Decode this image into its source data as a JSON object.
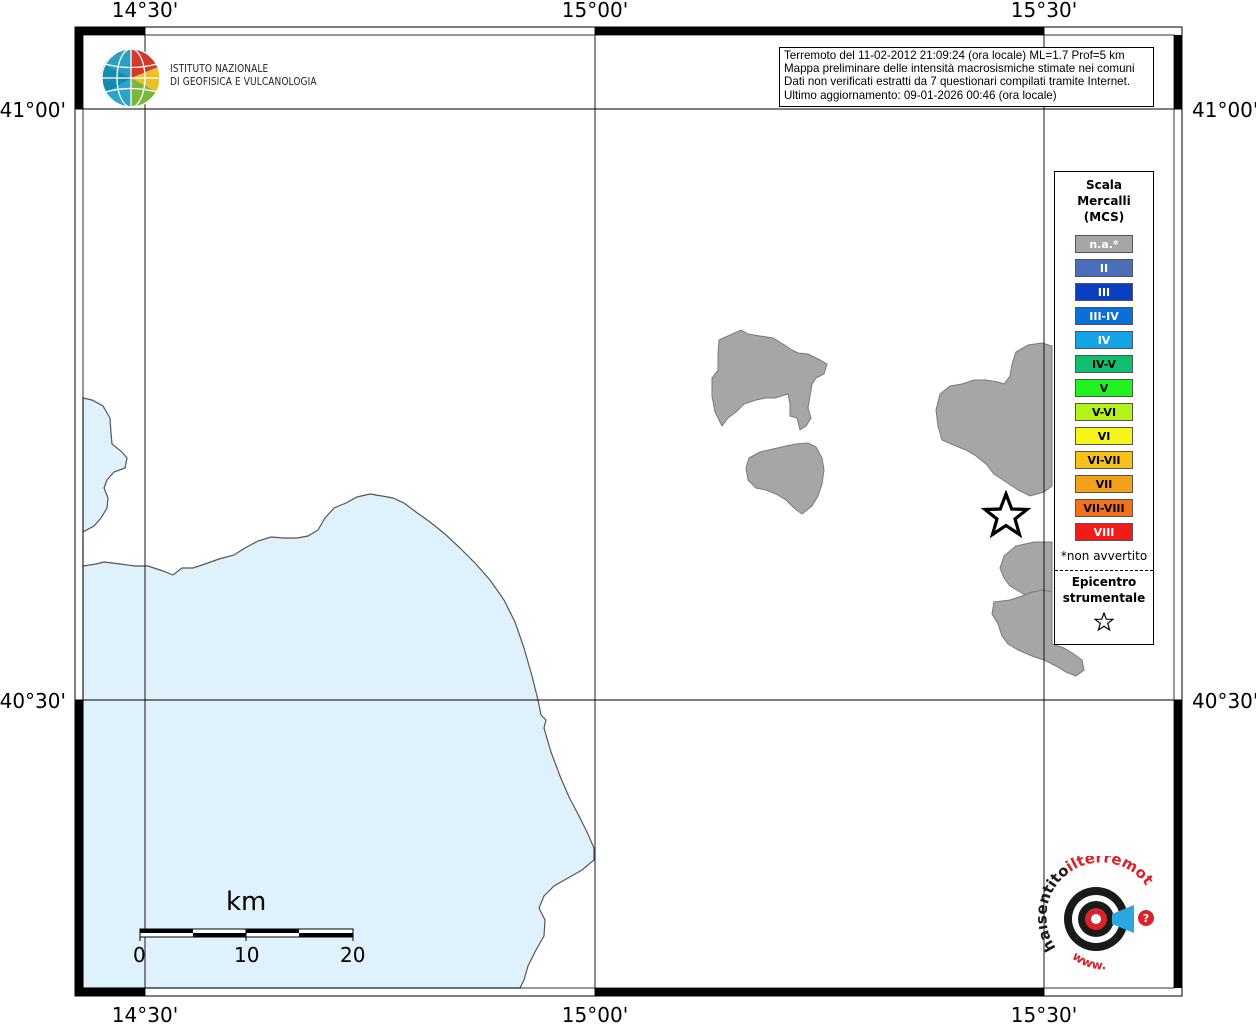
{
  "map": {
    "graticule": {
      "top_labels": [
        "14°30'",
        "15°00'",
        "15°30'"
      ],
      "bottom_labels": [
        "14°30'",
        "15°00'",
        "15°30'"
      ],
      "left_labels": [
        "41°00'",
        "40°30'"
      ],
      "right_labels": [
        "41°00'",
        "40°30'"
      ]
    },
    "colors": {
      "sea": "#dff1fb",
      "coastline": "#555555",
      "municipality_fill": "#a6a6a6",
      "municipality_stroke": "#7a7a7a"
    }
  },
  "header": {
    "logo_line1": "ISTITUTO NAZIONALE",
    "logo_line2": "DI GEOFISICA E VULCANOLOGIA"
  },
  "info_box": {
    "line1": "Terremoto del 11-02-2012 21:09:24 (ora locale) ML=1.7 Prof=5 km",
    "line2": "Mappa preliminare delle intensità macrosismiche stimate nei comuni",
    "line3": "Dati non verificati estratti da 7 questionari compilati tramite Internet.",
    "line4": "Ultimo aggiornamento: 09-01-2026 00:46 (ora locale)"
  },
  "legend": {
    "title_line1": "Scala",
    "title_line2": "Mercalli",
    "title_line3": "(MCS)",
    "items": [
      {
        "label": "n.a.*",
        "color": "#a6a6a6",
        "text_color": "#ffffff"
      },
      {
        "label": "II",
        "color": "#4a6fb8",
        "text_color": "#ffffff"
      },
      {
        "label": "III",
        "color": "#0a3fc4",
        "text_color": "#ffffff"
      },
      {
        "label": "III-IV",
        "color": "#0a6fd8",
        "text_color": "#ffffff"
      },
      {
        "label": "IV",
        "color": "#14a3e6",
        "text_color": "#ffffff"
      },
      {
        "label": "IV-V",
        "color": "#0fbf6e",
        "text_color": "#000000"
      },
      {
        "label": "V",
        "color": "#1ff21f",
        "text_color": "#000000"
      },
      {
        "label": "V-VI",
        "color": "#b5f21a",
        "text_color": "#000000"
      },
      {
        "label": "VI",
        "color": "#f5f51a",
        "text_color": "#000000"
      },
      {
        "label": "VI-VII",
        "color": "#f5c21a",
        "text_color": "#000000"
      },
      {
        "label": "VII",
        "color": "#f5a01a",
        "text_color": "#000000"
      },
      {
        "label": "VII-VIII",
        "color": "#f2721a",
        "text_color": "#000000"
      },
      {
        "label": "VIII",
        "color": "#f21a1a",
        "text_color": "#ffffff"
      }
    ],
    "note": "*non avvertito",
    "epicenter_line1": "Epicentro",
    "epicenter_line2": "strumentale"
  },
  "scale_bar": {
    "unit": "km",
    "tick_labels": [
      "0",
      "10",
      "20"
    ]
  },
  "footer_logo": {
    "text_main": "haisentito",
    "text_domain": "ilterremoto.it",
    "text_www": "www."
  }
}
